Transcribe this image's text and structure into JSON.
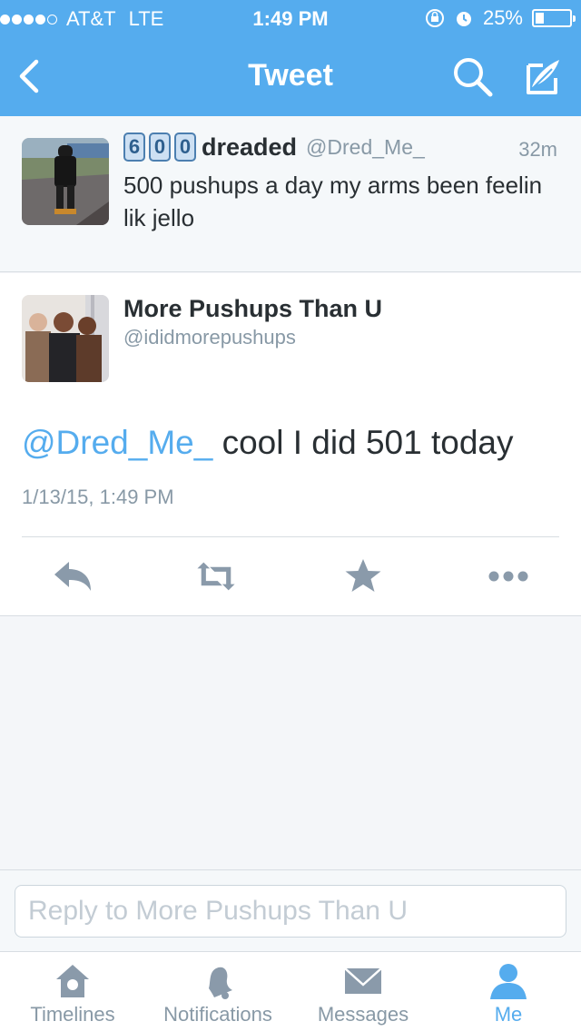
{
  "status_bar": {
    "carrier": "AT&T",
    "network": "LTE",
    "time": "1:49 PM",
    "battery_percent": "25%",
    "battery_level": 0.25,
    "signal_bars": 4
  },
  "nav": {
    "title": "Tweet",
    "back_icon": "chevron-left-icon",
    "search_icon": "search-icon",
    "compose_icon": "compose-icon"
  },
  "original_tweet": {
    "badges": [
      "6",
      "0",
      "0"
    ],
    "name": "dreaded",
    "handle": "@Dred_Me_",
    "time_ago": "32m",
    "text": "500 pushups a day my arms been feelin lik jello"
  },
  "tweet": {
    "name": "More Pushups Than U",
    "handle": "@ididmorepushups",
    "mention": "@Dred_Me_",
    "text": " cool I did 501 today",
    "timestamp": "1/13/15, 1:49 PM",
    "actions": [
      "reply-icon",
      "retweet-icon",
      "favorite-icon",
      "more-icon"
    ]
  },
  "reply": {
    "placeholder": "Reply to More Pushups Than U"
  },
  "tabs": [
    {
      "label": "Timelines",
      "icon": "home-icon"
    },
    {
      "label": "Notifications",
      "icon": "bell-icon"
    },
    {
      "label": "Messages",
      "icon": "envelope-icon"
    },
    {
      "label": "Me",
      "icon": "person-icon"
    }
  ],
  "colors": {
    "accent": "#55acee",
    "text": "#292f33",
    "muted": "#8899a6",
    "icon_gray": "#8a9aaa"
  }
}
